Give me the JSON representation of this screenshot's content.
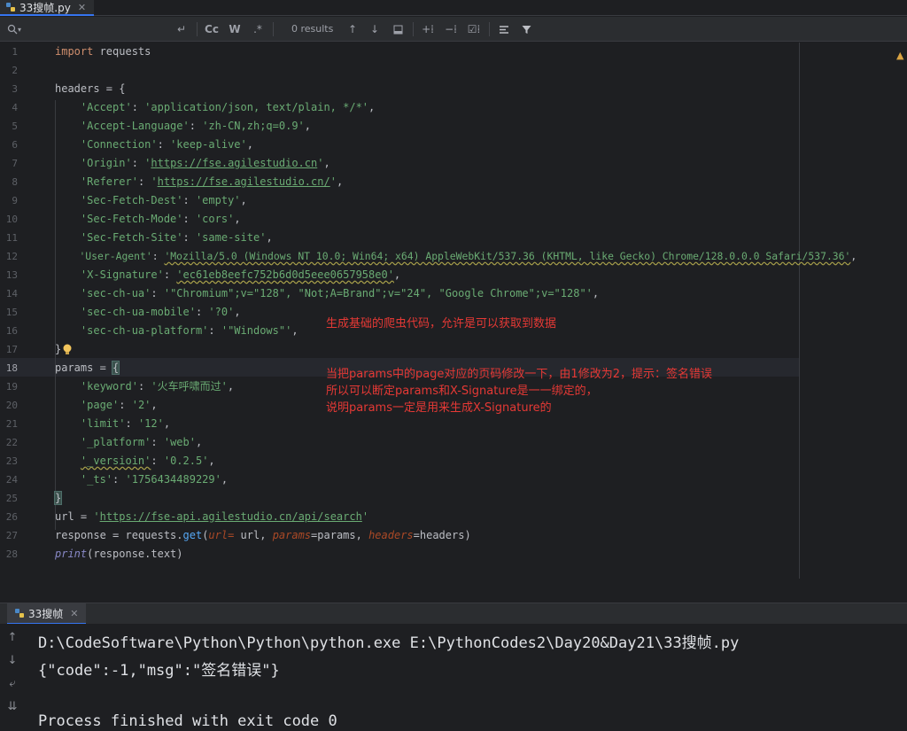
{
  "tab": {
    "label": "33搜帧.py"
  },
  "search": {
    "results": "0 results"
  },
  "editor": {
    "line_numbers": [
      "1",
      "2",
      "3",
      "4",
      "5",
      "6",
      "7",
      "8",
      "9",
      "10",
      "11",
      "12",
      "13",
      "14",
      "15",
      "16",
      "17",
      "18",
      "19",
      "20",
      "21",
      "22",
      "23",
      "24",
      "25",
      "26",
      "27",
      "28"
    ],
    "l1": {
      "kw": "import",
      "rest": " requests"
    },
    "l3": {
      "var": "headers",
      "rest": " = {"
    },
    "headers": [
      {
        "key": "'Accept'",
        "val": "'application/json, text/plain, */*'",
        "end": ","
      },
      {
        "key": "'Accept-Language'",
        "val": "'zh-CN,zh;q=0.9'",
        "end": ","
      },
      {
        "key": "'Connection'",
        "val": "'keep-alive'",
        "end": ","
      },
      {
        "key": "'Origin'",
        "pre": "'",
        "url": "https://fse.agilestudio.cn",
        "post": "'",
        "end": ","
      },
      {
        "key": "'Referer'",
        "pre": "'",
        "url": "https://fse.agilestudio.cn/",
        "post": "'",
        "end": ","
      },
      {
        "key": "'Sec-Fetch-Dest'",
        "val": "'empty'",
        "end": ","
      },
      {
        "key": "'Sec-Fetch-Mode'",
        "val": "'cors'",
        "end": ","
      },
      {
        "key": "'Sec-Fetch-Site'",
        "val": "'same-site'",
        "end": ","
      },
      {
        "key": "'User-Agent'",
        "val": "'Mozilla/5.0 (Windows NT 10.0; Win64; x64) AppleWebKit/537.36 (KHTML, like Gecko) Chrome/128.0.0.0 Safari/537.36'",
        "end": ","
      },
      {
        "key": "'X-Signature'",
        "val": "'ec61eb8eefc752b6d0d5eee0657958e0'",
        "end": ","
      },
      {
        "key": "'sec-ch-ua'",
        "val": "'\"Chromium\";v=\"128\", \"Not;A=Brand\";v=\"24\", \"Google Chrome\";v=\"128\"'",
        "end": ","
      },
      {
        "key": "'sec-ch-ua-mobile'",
        "val": "'?0'",
        "end": ","
      },
      {
        "key": "'sec-ch-ua-platform'",
        "val": "'\"Windows\"'",
        "end": ","
      }
    ],
    "l17": "}",
    "l18": {
      "var": "params",
      "rest": " = ",
      "brace": "{"
    },
    "params": [
      {
        "key": "'keyword'",
        "val": "'火车呼啸而过'",
        "end": ","
      },
      {
        "key": "'page'",
        "val": "'2'",
        "end": ","
      },
      {
        "key": "'limit'",
        "val": "'12'",
        "end": ","
      },
      {
        "key": "'_platform'",
        "val": "'web'",
        "end": ","
      },
      {
        "key": "'_versioin'",
        "val": "'0.2.5'",
        "end": ","
      },
      {
        "key": "'_ts'",
        "val": "'1756434489229'",
        "end": ","
      }
    ],
    "l25": "}",
    "l26": {
      "var": "url",
      "eq": " = ",
      "pre": "'",
      "url": "https://fse-api.agilestudio.cn/api/search",
      "post": "'"
    },
    "l27": {
      "var": "response",
      "eq": " = requests.",
      "fn": "get",
      "open": "(",
      "p1": "url=",
      "v1": " url, ",
      "p2": "params",
      "v2": "=params, ",
      "p3": "headers",
      "v3": "=headers)"
    },
    "l28": {
      "fn": "print",
      "rest": "(response.text)"
    }
  },
  "notes": {
    "n1": "生成基础的爬虫代码，允许是可以获取到数据",
    "n2": "当把params中的page对应的页码修改一下，由1修改为2，提示：签名错误",
    "n3": "所以可以断定params和X-Signature是一一绑定的，",
    "n4": "说明params一定是用来生成X-Signature的"
  },
  "run": {
    "tab_label": "33搜帧",
    "line1": "D:\\CodeSoftware\\Python\\Python\\python.exe E:\\PythonCodes2\\Day20&Day21\\33搜帧.py",
    "line2": "{\"code\":-1,\"msg\":\"签名错误\"}",
    "line3": "Process finished with exit code 0"
  },
  "colors": {
    "accent": "#3574f0",
    "note_red": "#e53935",
    "string_green": "#6aab73",
    "keyword_orange": "#cf8e6d"
  }
}
